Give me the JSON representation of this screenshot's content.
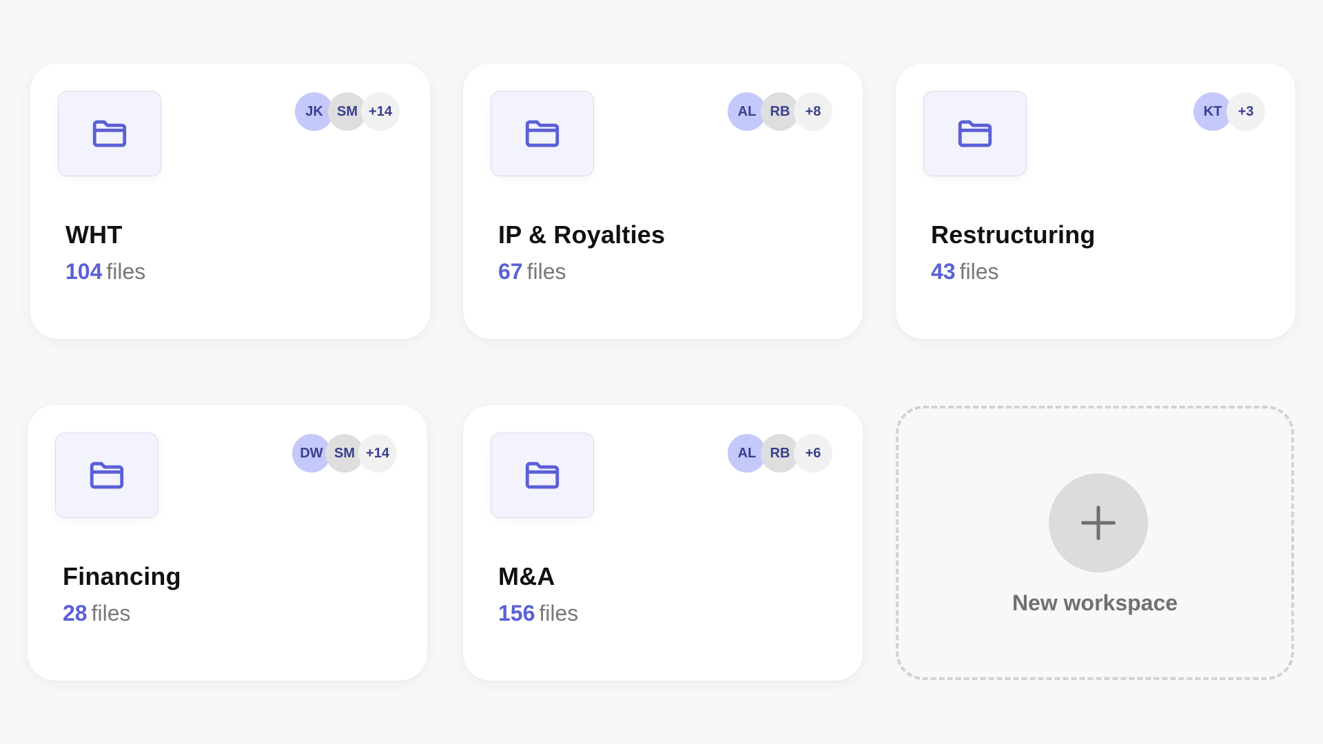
{
  "workspaces": [
    {
      "title": "WHT",
      "count": "104",
      "unit": "files",
      "avatars": [
        {
          "initials": "JK",
          "tone": "purple"
        },
        {
          "initials": "SM",
          "tone": "grey"
        }
      ],
      "more": "+14"
    },
    {
      "title": "IP & Royalties",
      "count": "67",
      "unit": "files",
      "avatars": [
        {
          "initials": "AL",
          "tone": "purple"
        },
        {
          "initials": "RB",
          "tone": "grey"
        }
      ],
      "more": "+8"
    },
    {
      "title": "Restructuring",
      "count": "43",
      "unit": "files",
      "avatars": [
        {
          "initials": "KT",
          "tone": "purple"
        }
      ],
      "more": "+3"
    },
    {
      "title": "Financing",
      "count": "28",
      "unit": "files",
      "avatars": [
        {
          "initials": "DW",
          "tone": "purple"
        },
        {
          "initials": "SM",
          "tone": "grey"
        }
      ],
      "more": "+14"
    },
    {
      "title": "M&A",
      "count": "156",
      "unit": "files",
      "avatars": [
        {
          "initials": "AL",
          "tone": "purple"
        },
        {
          "initials": "RB",
          "tone": "grey"
        }
      ],
      "more": "+6"
    }
  ],
  "new_workspace": {
    "label": "New workspace",
    "icon": "plus-icon"
  },
  "icons": {
    "folder": "folder-icon"
  },
  "colors": {
    "accent": "#5b5fd6",
    "avatar_purple": "#c5c8fa",
    "avatar_grey": "#dedede",
    "background": "#f8f8f8"
  }
}
